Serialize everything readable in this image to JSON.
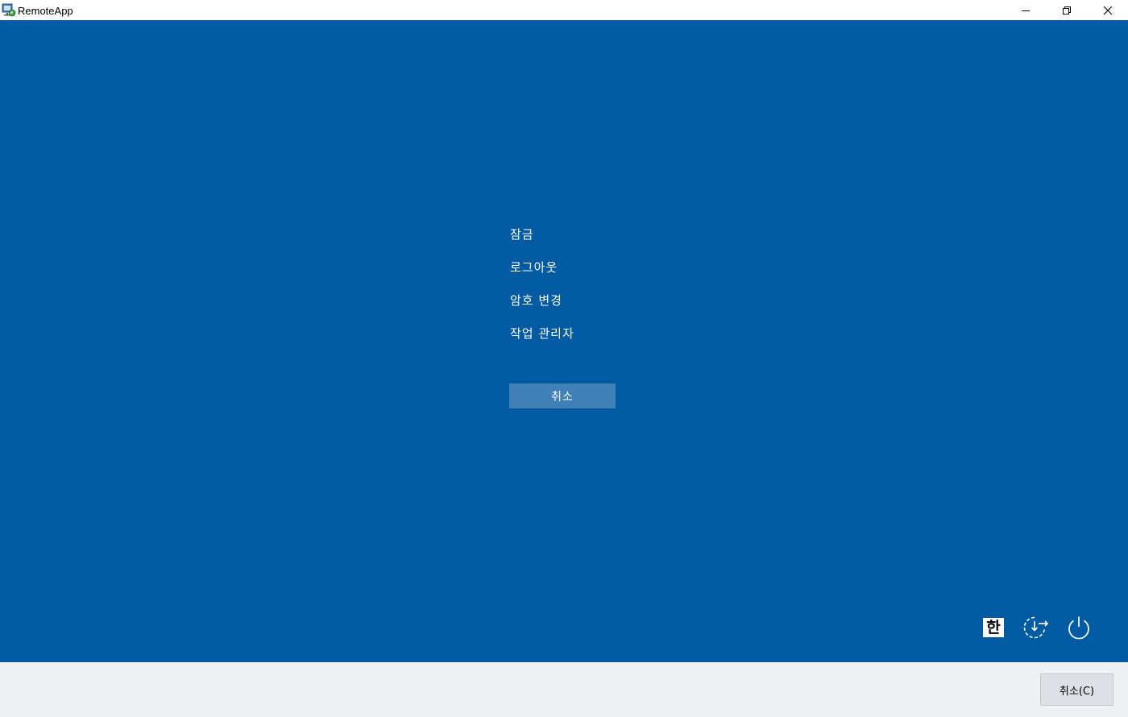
{
  "window": {
    "title": "RemoteApp"
  },
  "menu": {
    "items": [
      {
        "label": "잠금"
      },
      {
        "label": "로그아웃"
      },
      {
        "label": "암호 변경"
      },
      {
        "label": "작업 관리자"
      }
    ],
    "cancel_label": "취소"
  },
  "tray": {
    "ime_label": "한"
  },
  "footer": {
    "cancel_label": "취소(C)"
  },
  "colors": {
    "background_blue": "#005ba2",
    "button_blue": "#3f81b7",
    "footer_gray": "#eff0f1"
  },
  "icons": {
    "app": "remoteapp-icon",
    "minimize": "minimize-icon",
    "restore": "restore-icon",
    "close": "close-icon",
    "ease_of_access": "ease-of-access-icon",
    "power": "power-icon"
  }
}
